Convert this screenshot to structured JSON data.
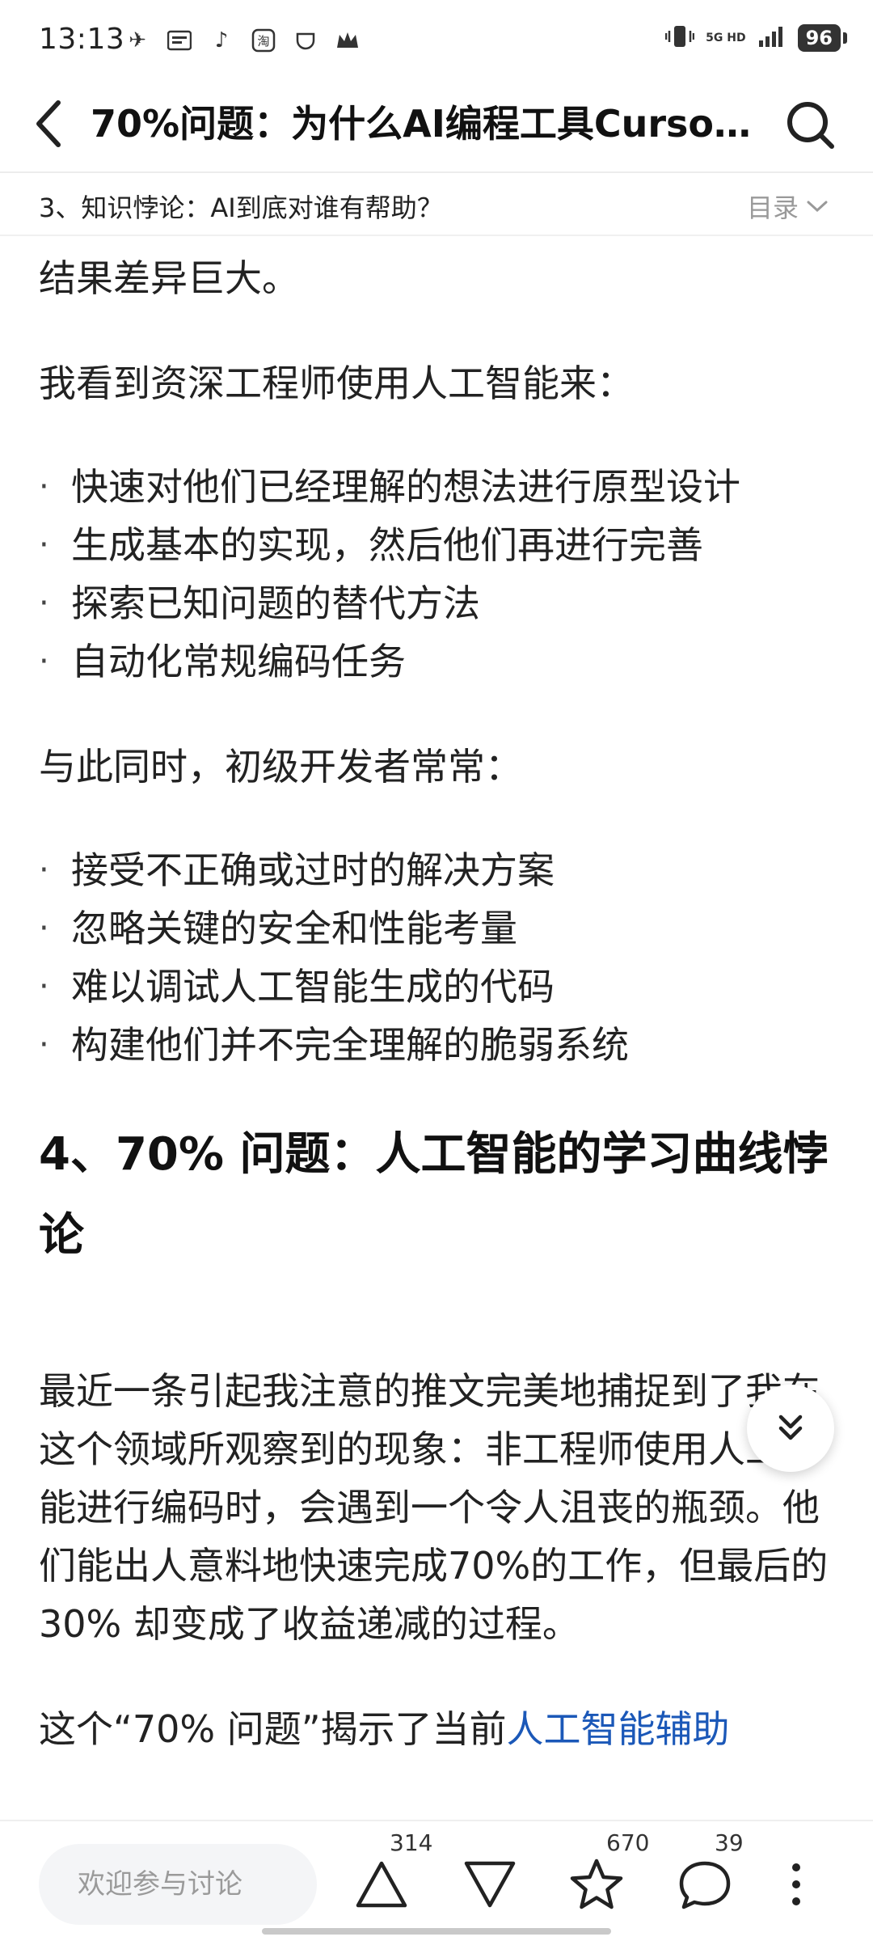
{
  "status_bar": {
    "time": "13:13",
    "network_top": "5G HD",
    "battery": "96"
  },
  "nav": {
    "title": "70%问题：为什么AI编程工具Cursor/c…"
  },
  "toc": {
    "current_section": "3、知识悖论：AI到底对谁有帮助？",
    "label": "目录"
  },
  "article": {
    "p_intro": "结果差异巨大。",
    "p_senior": "我看到资深工程师使用人工智能来：",
    "senior_items": [
      "快速对他们已经理解的想法进行原型设计",
      "生成基本的实现，然后他们再进行完善",
      "探索已知问题的替代方法",
      "自动化常规编码任务"
    ],
    "p_junior": "与此同时，初级开发者常常：",
    "junior_items": [
      "接受不正确或过时的解决方案",
      "忽略关键的安全和性能考量",
      "难以调试人工智能生成的代码",
      "构建他们并不完全理解的脆弱系统"
    ],
    "heading_4": "4、70% 问题：人工智能的学习曲线悖论",
    "p_tweet": "最近一条引起我注意的推文完美地捕捉到了我在这个领域所观察到的现象：非工程师使用人工智能进行编码时，会遇到一个令人沮丧的瓶颈。他们能出人意料地快速完成70%的工作，但最后的30% 却变成了收益递减的过程。",
    "p_last_prefix": "这个“70% 问题”揭示了当前",
    "p_last_link": "人工智能辅助"
  },
  "bottom_bar": {
    "comment_placeholder": "欢迎参与讨论",
    "upvote_count": "314",
    "favorite_count": "670",
    "comment_count": "39"
  },
  "colors": {
    "link": "#1b58b8",
    "text": "#222222"
  }
}
